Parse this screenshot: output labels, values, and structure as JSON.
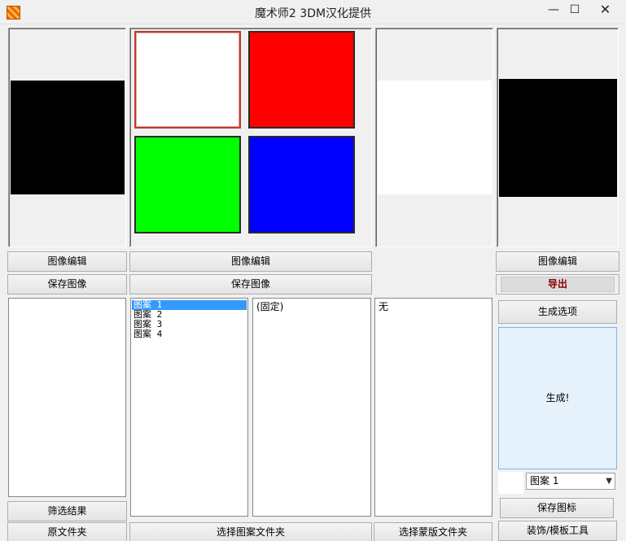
{
  "window": {
    "title": "魔术师2 3DM汉化提供",
    "minimize": "—",
    "maximize": "☐",
    "close": "✕"
  },
  "col1": {
    "edit_label": "图像编辑",
    "save_label": "保存图像",
    "filter_results_label": "筛选结果",
    "source_folder_label": "原文件夹"
  },
  "col2": {
    "edit_label": "图像编辑",
    "save_label": "保存图像",
    "pattern_list": [
      "图案 1",
      "图案 2",
      "图案 3",
      "图案 4"
    ],
    "fixed_list": [
      "(固定)"
    ],
    "select_pattern_folder_label": "选择图案文件夹",
    "swatch_colors": [
      "#ffffff",
      "#ff0000",
      "#00ff00",
      "#0000ff"
    ]
  },
  "col4": {
    "mask_list": [
      "无"
    ],
    "select_mask_folder_label": "选择蒙版文件夹"
  },
  "col5": {
    "edit_label": "图像编辑",
    "export_label": "导出",
    "gen_options_label": "生成选项",
    "generate_label": "生成!",
    "pattern_select_value": "图案 1",
    "save_icon_label": "保存图标",
    "decor_tools_label": "装饰/模板工具"
  },
  "colors": {
    "selected_list_bg": "#3399ff",
    "export_text": "#8b0000",
    "generate_bg": "#e5f1fb"
  }
}
